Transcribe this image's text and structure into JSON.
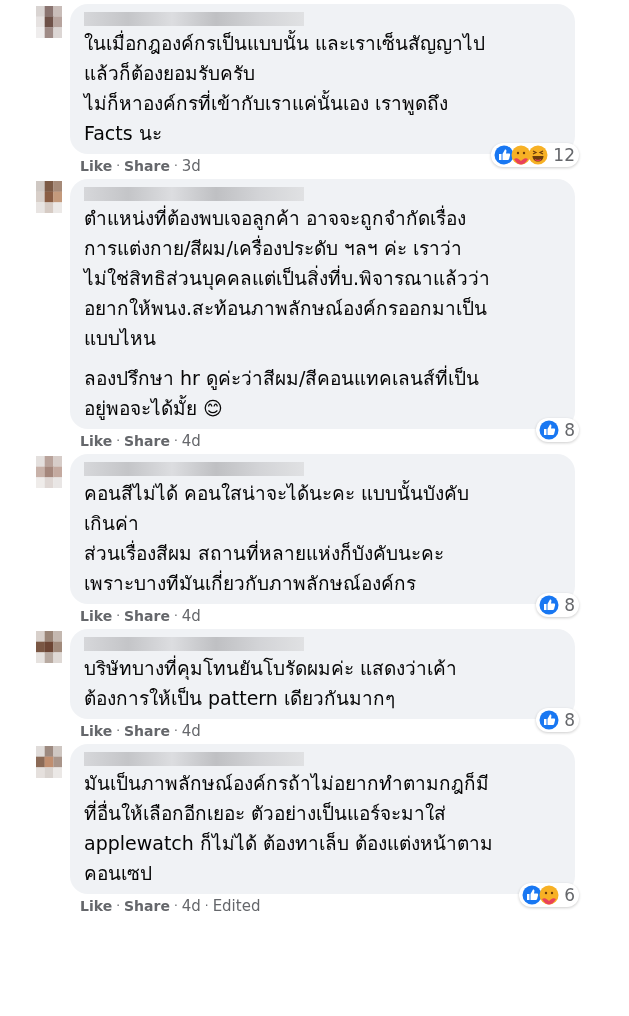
{
  "comments": [
    {
      "paragraphs": [
        [
          "ในเมื่อกฎองค์กรเป็นแบบนั้น และเราเซ็นสัญญาไป",
          "แล้วก็ต้องยอมรับครับ",
          "ไม่ก็หาองค์กรที่เข้ากับเราแค่นั้นเอง เราพูดถึง",
          "Facts นะ"
        ]
      ],
      "reactions": [
        {
          "kind": "like"
        },
        {
          "kind": "care"
        },
        {
          "kind": "haha"
        }
      ],
      "reaction_count": "12",
      "separator": "·",
      "actions": [
        "Like",
        "Share"
      ],
      "time": "3d"
    },
    {
      "paragraphs": [
        [
          "ตำแหน่งที่ต้องพบเจอลูกค้า อาจจะถูกจำกัดเรื่อง",
          "การแต่งกาย/สีผม/เครื่องประดับ ฯลฯ ค่ะ เราว่า",
          "ไม่ใช่สิทธิส่วนบุคคลแต่เป็นสิ่งที่บ.พิจารณาแล้วว่า",
          "อยากให้พนง.สะท้อนภาพลักษณ์องค์กรออกมาเป็น",
          "แบบไหน"
        ],
        [
          "ลองปรึกษา hr ดูค่ะว่าสีผม/สีคอนแทคเลนส์ที่เป็น",
          "อยู่พอจะได้มั้ย 😊"
        ]
      ],
      "reactions": [
        {
          "kind": "like"
        }
      ],
      "reaction_count": "8",
      "separator": "·",
      "actions": [
        "Like",
        "Share"
      ],
      "time": "4d"
    },
    {
      "paragraphs": [
        [
          "คอนสีไม่ได้ คอนใสน่าจะได้นะคะ แบบนั้นบังคับ",
          "เกินค่า",
          "ส่วนเรื่องสีผม สถานที่หลายแห่งก็บังคับนะคะ",
          "เพราะบางทีมันเกี่ยวกับภาพลักษณ์องค์กร"
        ]
      ],
      "reactions": [
        {
          "kind": "like"
        }
      ],
      "reaction_count": "8",
      "separator": "·",
      "actions": [
        "Like",
        "Share"
      ],
      "time": "4d"
    },
    {
      "paragraphs": [
        [
          "บริษัทบางที่คุมโทนยันโบรัดผมค่ะ แสดงว่าเค้า",
          "ต้องการให้เป็น pattern เดียวกันมากๆ"
        ]
      ],
      "reactions": [
        {
          "kind": "like"
        }
      ],
      "reaction_count": "8",
      "separator": "·",
      "actions": [
        "Like",
        "Share"
      ],
      "time": "4d"
    },
    {
      "paragraphs": [
        [
          "มันเป็นภาพลักษณ์องค์กรถ้าไม่อยากทำตามกฎก็มี",
          "ที่อื่นให้เลือกอีกเยอะ ตัวอย่างเป็นแอร์จะมาใส่",
          "applewatch ก็ไม่ได้ ต้องทาเล็บ ต้องแต่งหน้าตาม",
          "คอนเซป"
        ]
      ],
      "reactions": [
        {
          "kind": "like"
        },
        {
          "kind": "care"
        }
      ],
      "reaction_count": "6",
      "separator": "·",
      "actions": [
        "Like",
        "Share"
      ],
      "time": "4d",
      "edited": "Edited"
    }
  ]
}
